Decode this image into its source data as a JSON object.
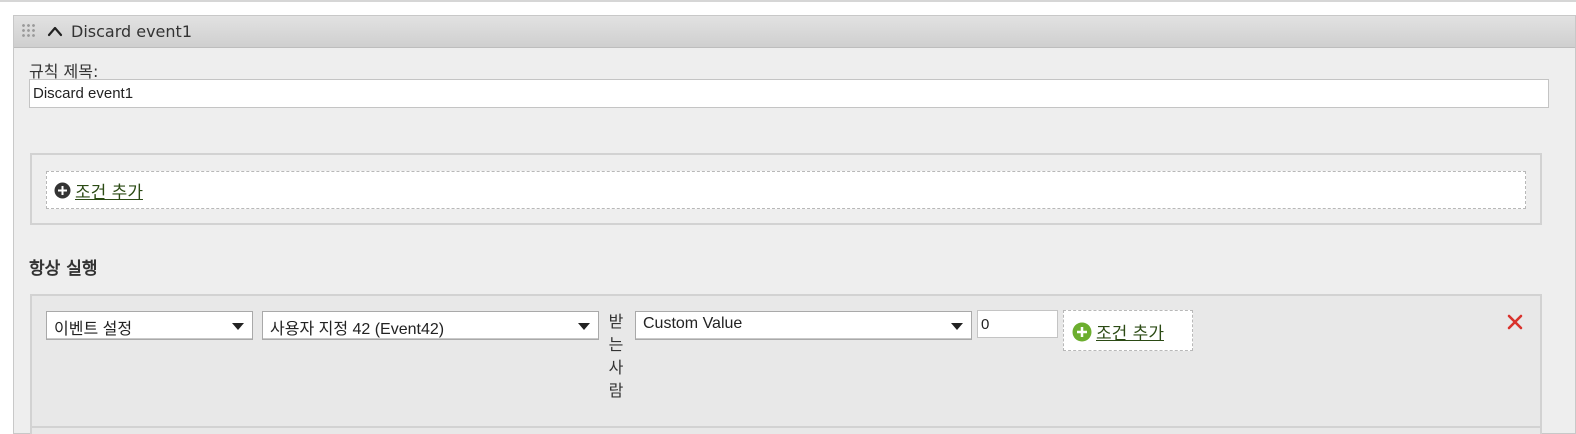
{
  "rule": {
    "header_title": "Discard event1",
    "title_label": "규칙 제목:",
    "title_value": "Discard event1"
  },
  "conditions": {
    "add_label": "조건 추가"
  },
  "actions": {
    "heading": "항상 실행",
    "action_select": "이벤트 설정",
    "event_select": "사용자 지정 42 (Event42)",
    "recipient_chars": [
      "받",
      "는",
      "사",
      "람"
    ],
    "value_type_select": "Custom Value",
    "value_input": "0",
    "add_label": "조건 추가"
  },
  "icons": {
    "grip": "drag-handle-icon",
    "collapse": "chevron-up-icon",
    "add_dark": "plus-circle-icon",
    "add_green": "plus-circle-green-icon",
    "remove": "close-icon"
  },
  "colors": {
    "link": "#2b4a14",
    "add_green": "#6cae2f",
    "remove_red": "#d9322c"
  }
}
